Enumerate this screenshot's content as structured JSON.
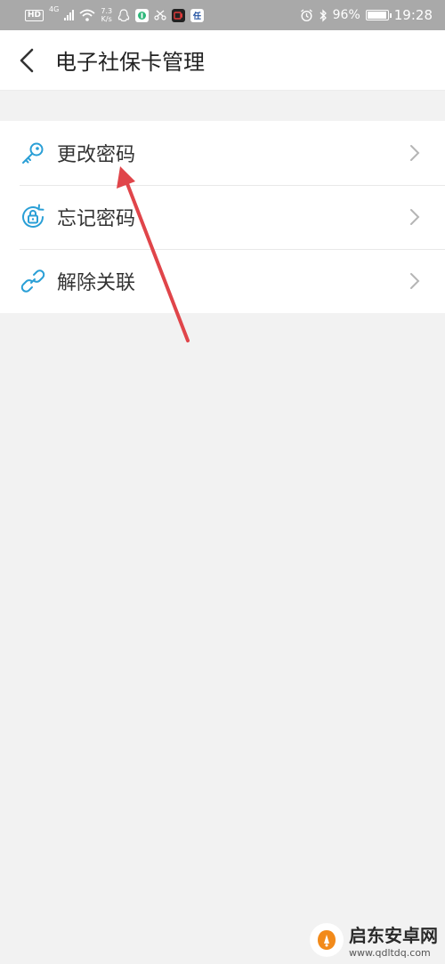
{
  "status_bar": {
    "hd": "HD",
    "network": "4G",
    "speed_value": "7.3",
    "speed_unit": "K/s",
    "app_icon": "任",
    "battery_percent": "96%",
    "battery_level": 0.96,
    "time": "19:28"
  },
  "header": {
    "title": "电子社保卡管理",
    "back_icon": "chevron-left-icon"
  },
  "menu": {
    "items": [
      {
        "label": "更改密码",
        "icon": "key-icon"
      },
      {
        "label": "忘记密码",
        "icon": "lock-reset-icon"
      },
      {
        "label": "解除关联",
        "icon": "link-icon"
      }
    ]
  },
  "watermark": {
    "name": "启东安卓网",
    "url": "www.qdltdq.com"
  },
  "colors": {
    "accent": "#2a9fd6",
    "status_bar": "#a9a9a9",
    "background": "#f2f2f2",
    "annotation": "#e0454a"
  }
}
